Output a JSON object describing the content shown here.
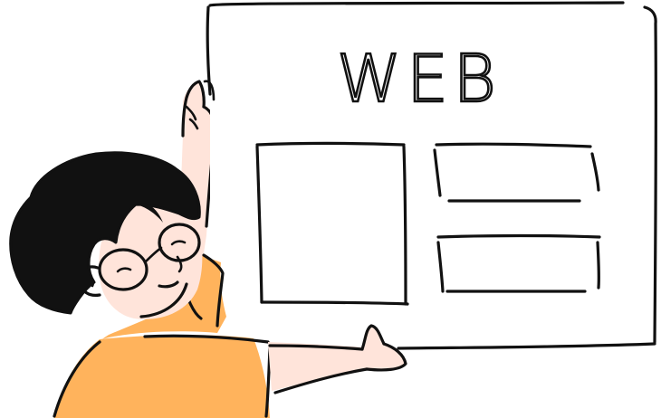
{
  "illustration": {
    "board": {
      "title": "WEB"
    },
    "colors": {
      "ink": "#111111",
      "shirt": "#FFB35C",
      "skin": "#FFE4DA",
      "hair": "#111111",
      "background": "#FFFFFF"
    }
  }
}
